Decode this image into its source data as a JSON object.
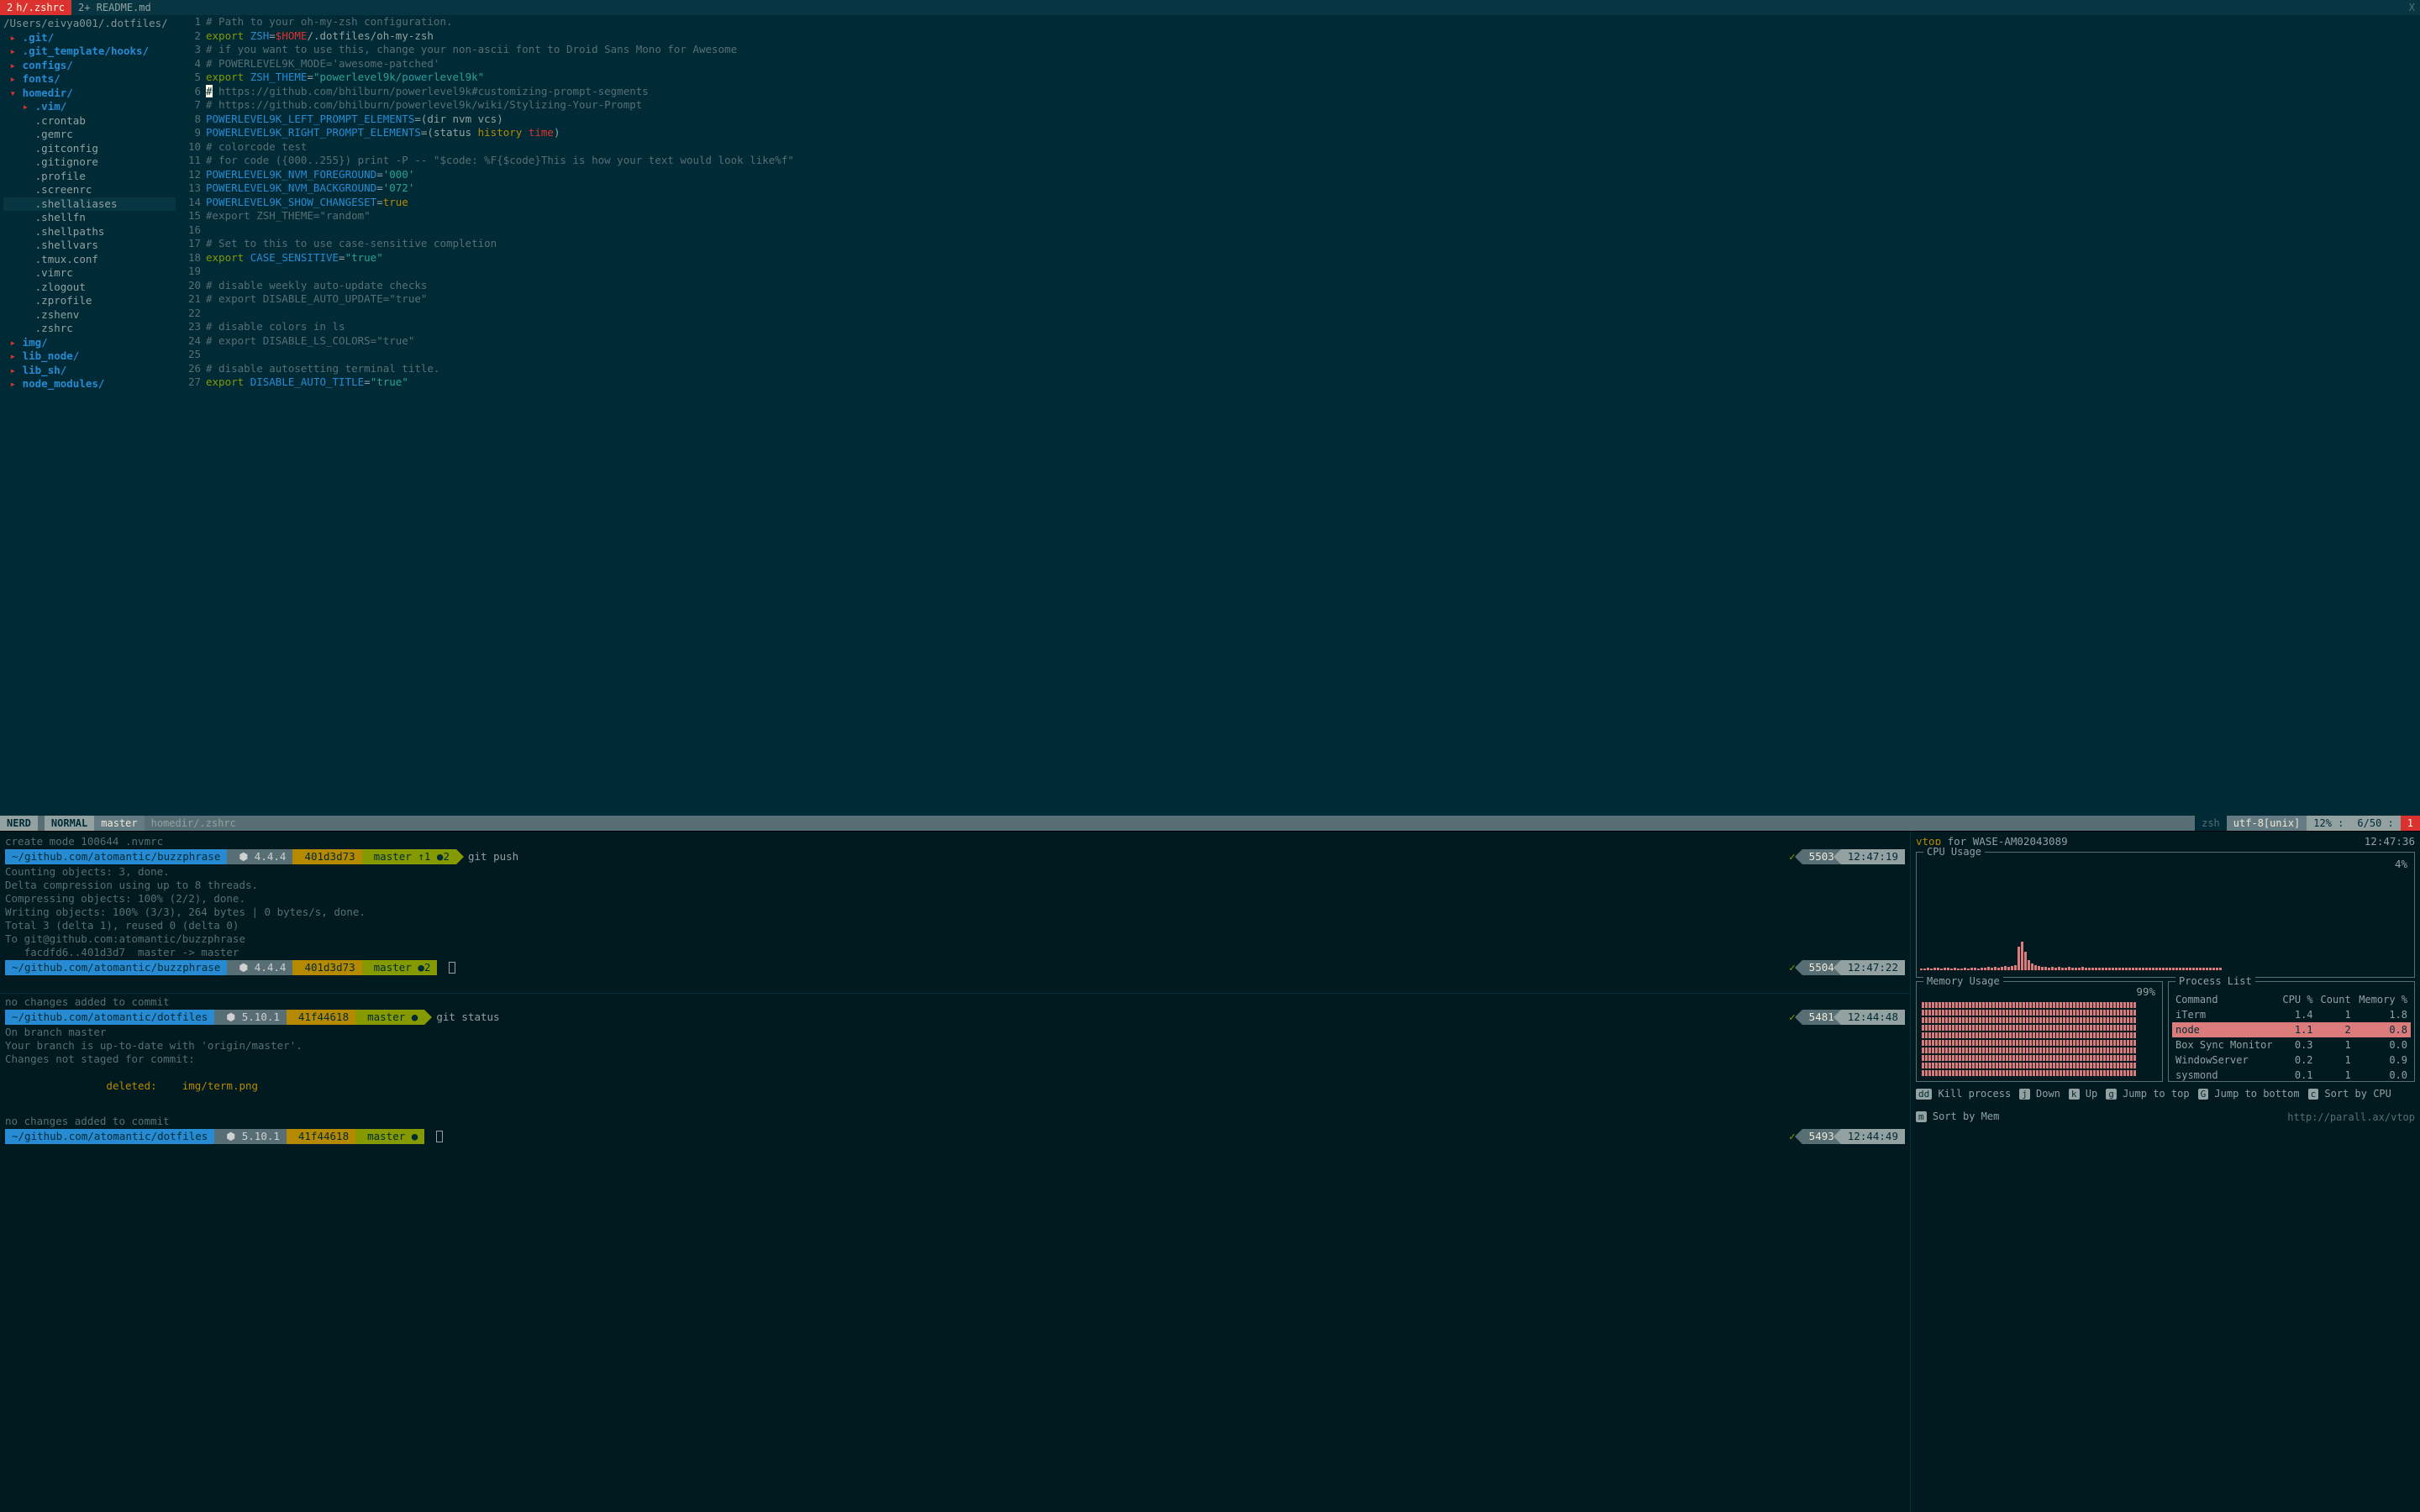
{
  "tabs": {
    "active_num": "2",
    "active_label": "h/.zshrc",
    "inactive_label": "2+ README.md",
    "close": "X"
  },
  "tree": {
    "root": "/Users/eivya001/.dotfiles/",
    "items": [
      {
        "depth": 0,
        "type": "dir",
        "open": false,
        "label": ".git/"
      },
      {
        "depth": 0,
        "type": "dir",
        "open": false,
        "label": ".git_template/hooks/"
      },
      {
        "depth": 0,
        "type": "dir",
        "open": false,
        "label": "configs/"
      },
      {
        "depth": 0,
        "type": "dir",
        "open": false,
        "label": "fonts/"
      },
      {
        "depth": 0,
        "type": "dir",
        "open": true,
        "label": "homedir/"
      },
      {
        "depth": 1,
        "type": "dir",
        "open": false,
        "label": ".vim/"
      },
      {
        "depth": 1,
        "type": "file",
        "label": ".crontab"
      },
      {
        "depth": 1,
        "type": "file",
        "label": ".gemrc"
      },
      {
        "depth": 1,
        "type": "file",
        "label": ".gitconfig"
      },
      {
        "depth": 1,
        "type": "file",
        "label": ".gitignore"
      },
      {
        "depth": 1,
        "type": "file",
        "label": ".profile"
      },
      {
        "depth": 1,
        "type": "file",
        "label": ".screenrc"
      },
      {
        "depth": 1,
        "type": "file",
        "label": ".shellaliases",
        "selected": true
      },
      {
        "depth": 1,
        "type": "file",
        "label": ".shellfn"
      },
      {
        "depth": 1,
        "type": "file",
        "label": ".shellpaths"
      },
      {
        "depth": 1,
        "type": "file",
        "label": ".shellvars"
      },
      {
        "depth": 1,
        "type": "file",
        "label": ".tmux.conf"
      },
      {
        "depth": 1,
        "type": "file",
        "label": ".vimrc"
      },
      {
        "depth": 1,
        "type": "file",
        "label": ".zlogout"
      },
      {
        "depth": 1,
        "type": "file",
        "label": ".zprofile"
      },
      {
        "depth": 1,
        "type": "file",
        "label": ".zshenv"
      },
      {
        "depth": 1,
        "type": "file",
        "label": ".zshrc"
      },
      {
        "depth": 0,
        "type": "dir",
        "open": false,
        "label": "img/"
      },
      {
        "depth": 0,
        "type": "dir",
        "open": false,
        "label": "lib_node/"
      },
      {
        "depth": 0,
        "type": "dir",
        "open": false,
        "label": "lib_sh/"
      },
      {
        "depth": 0,
        "type": "dir",
        "open": false,
        "label": "node_modules/"
      }
    ]
  },
  "editor": {
    "lines": [
      [
        {
          "t": "# Path to your oh-my-zsh configuration.",
          "c": "c-comment"
        }
      ],
      [
        {
          "t": "export ",
          "c": "c-keyword"
        },
        {
          "t": "ZSH",
          "c": "c-ident"
        },
        {
          "t": "="
        },
        {
          "t": "$HOME",
          "c": "c-var"
        },
        {
          "t": "/.dotfiles/oh-my-zsh"
        }
      ],
      [
        {
          "t": "# if you want to use this, change your non-ascii font to Droid Sans Mono for Awesome",
          "c": "c-comment"
        }
      ],
      [
        {
          "t": "# POWERLEVEL9K_MODE='awesome-patched'",
          "c": "c-comment"
        }
      ],
      [
        {
          "t": "export ",
          "c": "c-keyword"
        },
        {
          "t": "ZSH_THEME",
          "c": "c-ident"
        },
        {
          "t": "="
        },
        {
          "t": "\"powerlevel9k/powerlevel9k\"",
          "c": "c-string"
        }
      ],
      [
        {
          "t": "#",
          "c": "cursor"
        },
        {
          "t": " https://github.com/bhilburn/powerlevel9k#customizing-prompt-segments",
          "c": "c-comment"
        }
      ],
      [
        {
          "t": "# https://github.com/bhilburn/powerlevel9k/wiki/Stylizing-Your-Prompt",
          "c": "c-comment"
        }
      ],
      [
        {
          "t": "POWERLEVEL9K_LEFT_PROMPT_ELEMENTS",
          "c": "c-ident"
        },
        {
          "t": "=("
        },
        {
          "t": "dir nvm vcs"
        },
        {
          "t": ")"
        }
      ],
      [
        {
          "t": "POWERLEVEL9K_RIGHT_PROMPT_ELEMENTS",
          "c": "c-ident"
        },
        {
          "t": "=("
        },
        {
          "t": "status "
        },
        {
          "t": "history",
          "c": "c-const"
        },
        {
          "t": " "
        },
        {
          "t": "time",
          "c": "c-var"
        },
        {
          "t": ")"
        }
      ],
      [
        {
          "t": "# colorcode test",
          "c": "c-comment"
        }
      ],
      [
        {
          "t": "# for code ({000..255}) print -P -- \"$code: %F{$code}This is how your text would look like%f\"",
          "c": "c-comment"
        }
      ],
      [
        {
          "t": "POWERLEVEL9K_NVM_FOREGROUND",
          "c": "c-ident"
        },
        {
          "t": "="
        },
        {
          "t": "'000'",
          "c": "c-string"
        }
      ],
      [
        {
          "t": "POWERLEVEL9K_NVM_BACKGROUND",
          "c": "c-ident"
        },
        {
          "t": "="
        },
        {
          "t": "'072'",
          "c": "c-string"
        }
      ],
      [
        {
          "t": "POWERLEVEL9K_SHOW_CHANGESET",
          "c": "c-ident"
        },
        {
          "t": "="
        },
        {
          "t": "true",
          "c": "c-const"
        }
      ],
      [
        {
          "t": "#export ZSH_THEME=\"random\"",
          "c": "c-comment"
        }
      ],
      [],
      [
        {
          "t": "# Set to this to use case-sensitive completion",
          "c": "c-comment"
        }
      ],
      [
        {
          "t": "export ",
          "c": "c-keyword"
        },
        {
          "t": "CASE_SENSITIVE",
          "c": "c-ident"
        },
        {
          "t": "="
        },
        {
          "t": "\"true\"",
          "c": "c-string"
        }
      ],
      [],
      [
        {
          "t": "# disable weekly auto-update checks",
          "c": "c-comment"
        }
      ],
      [
        {
          "t": "# export DISABLE_AUTO_UPDATE=\"true\"",
          "c": "c-comment"
        }
      ],
      [],
      [
        {
          "t": "# disable colors in ls",
          "c": "c-comment"
        }
      ],
      [
        {
          "t": "# export DISABLE_LS_COLORS=\"true\"",
          "c": "c-comment"
        }
      ],
      [],
      [
        {
          "t": "# disable autosetting terminal title.",
          "c": "c-comment"
        }
      ],
      [
        {
          "t": "export ",
          "c": "c-keyword"
        },
        {
          "t": "DISABLE_AUTO_TITLE",
          "c": "c-ident"
        },
        {
          "t": "="
        },
        {
          "t": "\"true\"",
          "c": "c-string"
        }
      ]
    ]
  },
  "statusline": {
    "nerd": "NERD",
    "mode": "NORMAL",
    "branch": "master",
    "file": "homedir/.zshrc",
    "filetype": "zsh",
    "encoding": "utf-8[unix]",
    "percent": "12% :",
    "position": "6/50 :",
    "col": "1"
  },
  "term_left": {
    "pre1": "create mode 100644 .nvmrc",
    "prompt1": {
      "path": "~/github.com/atomantic/buzzphrase",
      "node": "⬢ 4.4.4",
      "hash": "401d3d73",
      "branch": " master ↑1 ●2",
      "cmd": "git push",
      "ok": "✓",
      "num": "5503",
      "time": "12:47:19"
    },
    "out1": [
      "Counting objects: 3, done.",
      "Delta compression using up to 8 threads.",
      "Compressing objects: 100% (2/2), done.",
      "Writing objects: 100% (3/3), 264 bytes | 0 bytes/s, done.",
      "Total 3 (delta 1), reused 0 (delta 0)",
      "To git@github.com:atomantic/buzzphrase",
      "   facdfd6..401d3d7  master -> master"
    ],
    "prompt2": {
      "path": "~/github.com/atomantic/buzzphrase",
      "node": "⬢ 4.4.4",
      "hash": "401d3d73",
      "branch": " master ●2",
      "cmd": "",
      "ok": "✓",
      "num": "5504",
      "time": "12:47:22"
    },
    "pre3": "no changes added to commit",
    "prompt3": {
      "path": "~/github.com/atomantic/dotfiles",
      "node": "⬢ 5.10.1",
      "hash": "41f44618",
      "branch": " master ●",
      "cmd": "git status",
      "ok": "✓",
      "num": "5481",
      "time": "12:44:48"
    },
    "out3": [
      "On branch master",
      "Your branch is up-to-date with 'origin/master'.",
      "Changes not staged for commit:"
    ],
    "out3_deleted_label": "        deleted:",
    "out3_deleted_file": "    img/term.png",
    "pre4": "no changes added to commit",
    "prompt4": {
      "path": "~/github.com/atomantic/dotfiles",
      "node": "⬢ 5.10.1",
      "hash": "41f44618",
      "branch": " master ●",
      "cmd": "",
      "ok": "✓",
      "num": "5493",
      "time": "12:44:49"
    }
  },
  "vtop": {
    "title_app": "vtop",
    "title_for": " for WASE-AM02043089",
    "clock": "12:47:36",
    "cpu_label": "CPU Usage",
    "cpu_pct": "4%",
    "cpu_bars": [
      2,
      2,
      3,
      2,
      3,
      3,
      2,
      3,
      3,
      2,
      3,
      2,
      2,
      3,
      2,
      3,
      3,
      2,
      3,
      3,
      4,
      3,
      4,
      3,
      4,
      5,
      4,
      5,
      6,
      28,
      34,
      22,
      12,
      8,
      6,
      5,
      4,
      4,
      3,
      4,
      3,
      4,
      3,
      3,
      4,
      3,
      3,
      3,
      4,
      3,
      3,
      3,
      3,
      3,
      3,
      3,
      3,
      3,
      3,
      3,
      3,
      3,
      3,
      3,
      3,
      3,
      3,
      3,
      3,
      3,
      3,
      3,
      3,
      3,
      3,
      3,
      3,
      3,
      3,
      3,
      3,
      3,
      3,
      3,
      3,
      3,
      3,
      3,
      3,
      3
    ],
    "mem_label": "Memory Usage",
    "mem_pct": "99%",
    "proc_label": "Process List",
    "proc_headers": [
      "Command",
      "CPU %",
      "Count",
      "Memory %"
    ],
    "proc_rows": [
      {
        "cmd": "iTerm",
        "cpu": "1.4",
        "count": "1",
        "mem": "1.8"
      },
      {
        "cmd": "node",
        "cpu": "1.1",
        "count": "2",
        "mem": "0.8",
        "selected": true
      },
      {
        "cmd": "Box Sync Monitor",
        "cpu": "0.3",
        "count": "1",
        "mem": "0.0"
      },
      {
        "cmd": "WindowServer",
        "cpu": "0.2",
        "count": "1",
        "mem": "0.9"
      },
      {
        "cmd": "sysmond",
        "cpu": "0.1",
        "count": "1",
        "mem": "0.0"
      }
    ],
    "footer": [
      {
        "k": "dd",
        "l": "Kill process"
      },
      {
        "k": "j",
        "l": "Down"
      },
      {
        "k": "k",
        "l": "Up"
      },
      {
        "k": "g",
        "l": "Jump to top"
      },
      {
        "k": "G",
        "l": "Jump to bottom"
      },
      {
        "k": "c",
        "l": "Sort by CPU"
      },
      {
        "k": "m",
        "l": "Sort by Mem"
      }
    ],
    "url": "http://parall.ax/vtop"
  }
}
